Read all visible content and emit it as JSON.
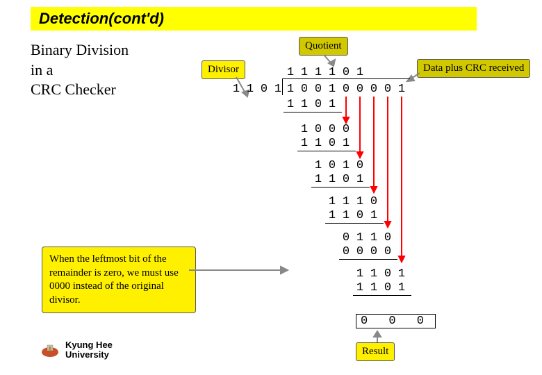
{
  "title": "Detection(cont'd)",
  "subtitle_line1": "Binary Division",
  "subtitle_line2": "in a",
  "subtitle_line3": "CRC Checker",
  "university_l1": "Kyung Hee",
  "university_l2": "University",
  "labels": {
    "quotient": "Quotient",
    "divisor": "Divisor",
    "data_crc": "Data plus CRC received",
    "note": "When the leftmost bit of the remainder is zero, we must use 0000 instead of the original divisor.",
    "result": "Result"
  },
  "division": {
    "quotient": [
      "1",
      "1",
      "1",
      "1",
      "0",
      "1"
    ],
    "divisor": [
      "1",
      "1",
      "0",
      "1"
    ],
    "dividend": [
      "1",
      "0",
      "0",
      "1",
      "0",
      "0",
      "0",
      "0",
      "1"
    ],
    "step1_sub": [
      "1",
      "1",
      "0",
      "1"
    ],
    "step2_rem": [
      "1",
      "0",
      "0",
      "0"
    ],
    "step2_sub": [
      "1",
      "1",
      "0",
      "1"
    ],
    "step3_rem": [
      "1",
      "0",
      "1",
      "0"
    ],
    "step3_sub": [
      "1",
      "1",
      "0",
      "1"
    ],
    "step4_rem": [
      "1",
      "1",
      "1",
      "0"
    ],
    "step4_sub": [
      "1",
      "1",
      "0",
      "1"
    ],
    "step5_rem": [
      "0",
      "1",
      "1",
      "0"
    ],
    "step5_sub": [
      "0",
      "0",
      "0",
      "0"
    ],
    "step6_rem": [
      "1",
      "1",
      "0",
      "1"
    ],
    "step6_sub": [
      "1",
      "1",
      "0",
      "1"
    ],
    "result": [
      "0",
      "0",
      "0"
    ]
  }
}
